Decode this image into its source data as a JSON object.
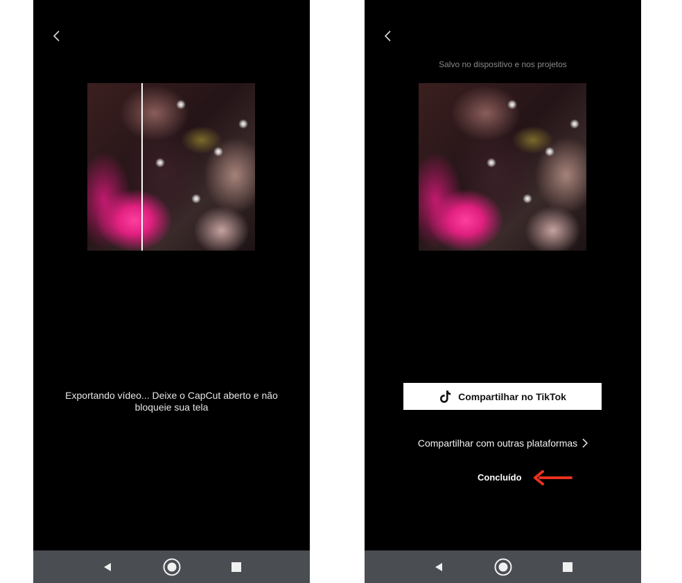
{
  "left_screen": {
    "export_message": "Exportando vídeo... Deixe o CapCut aberto e não bloqueie sua tela"
  },
  "right_screen": {
    "saved_message": "Salvo no dispositivo e nos projetos",
    "share_tiktok_label": "Compartilhar no TikTok",
    "share_other_label": "Compartilhar com outras plataformas",
    "done_label": "Concluído"
  },
  "icons": {
    "back": "chevron-left-icon",
    "tiktok": "tiktok-logo-icon",
    "share_other_chevron": "chevron-right-icon",
    "annotation_arrow": "red-arrow-icon",
    "nav_back": "triangle-back-icon",
    "nav_home": "circle-home-icon",
    "nav_recents": "square-recents-icon"
  },
  "colors": {
    "screen_background": "#000000",
    "nav_bar": "#4a4d52",
    "annotation_arrow": "#e8321f",
    "tiktok_button": "#ffffff"
  }
}
